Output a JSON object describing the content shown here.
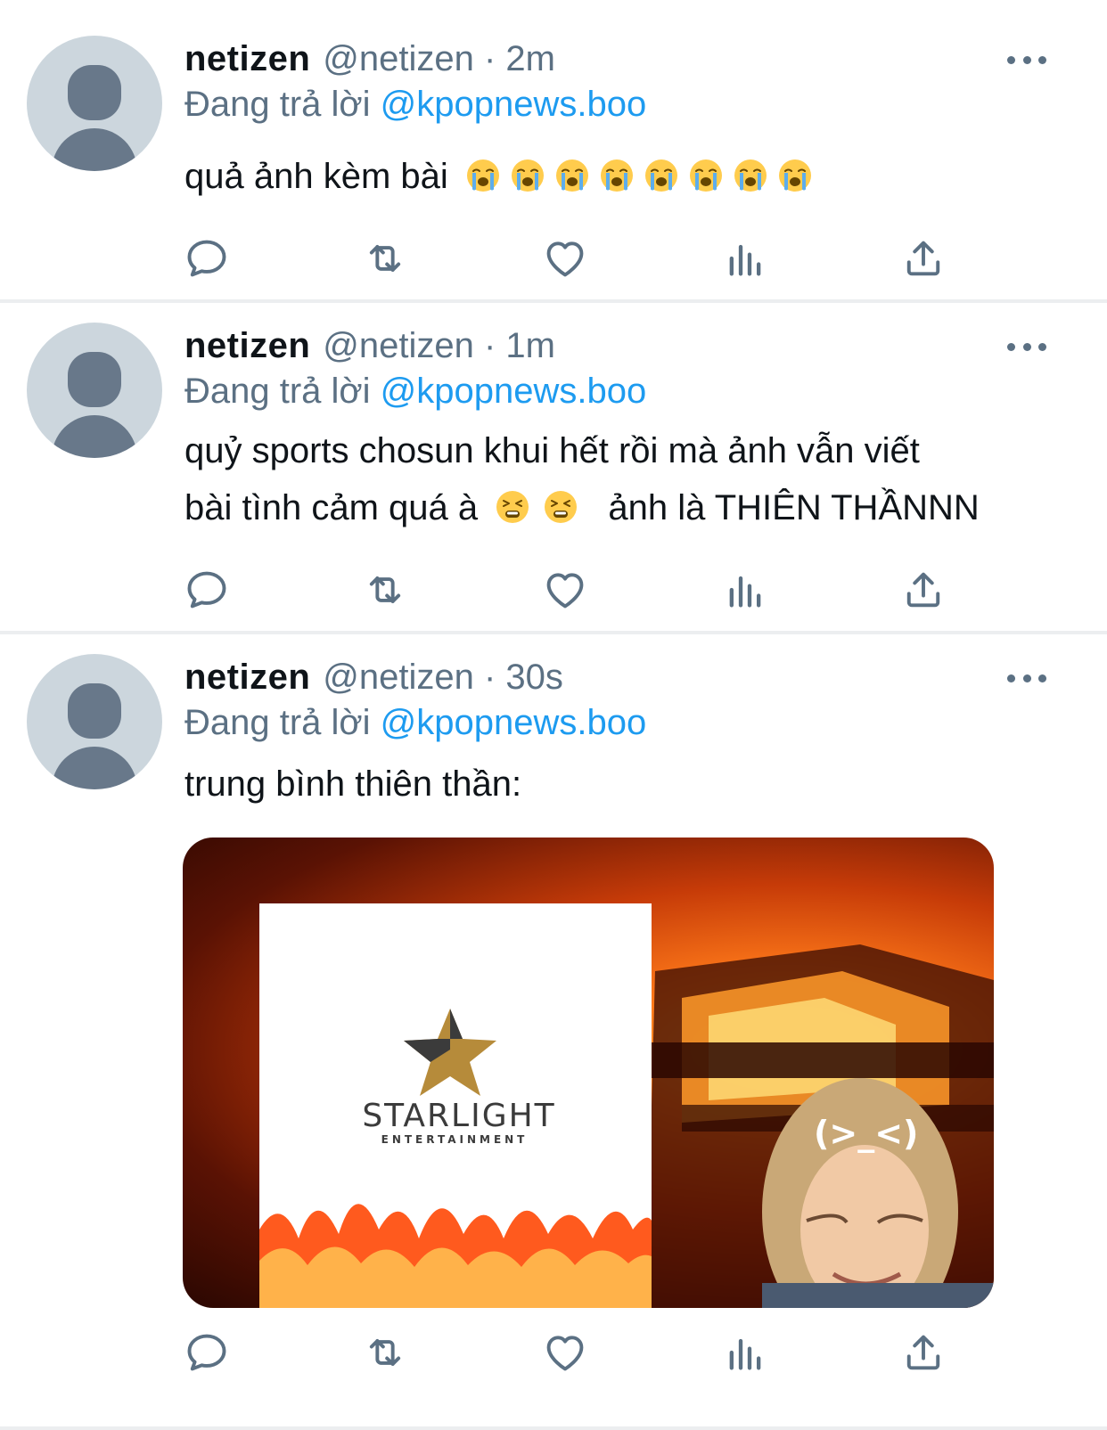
{
  "tweets": [
    {
      "name": "netizen",
      "handle_time": "@netizen · 2m",
      "reply_prefix": "Đang trả lời",
      "reply_mention": "@kpopnews.boo",
      "text_line1": "quả ảnh kèm bài",
      "emoji_count": 8,
      "emoji_name": "loudly-crying-face"
    },
    {
      "name": "netizen",
      "handle_time": "@netizen · 1m",
      "reply_prefix": "Đang trả lời",
      "reply_mention": "@kpopnews.boo",
      "text_line1": "quỷ sports chosun khui hết rồi mà ảnh vẫn viết",
      "text_line2_a": "bài tình cảm quá à",
      "text_line2_b": "ảnh là THIÊN THẦNNN",
      "emoji_name": "tired-face"
    },
    {
      "name": "netizen",
      "handle_time": "@netizen · 30s",
      "reply_prefix": "Đang trả lời",
      "reply_mention": "@kpopnews.boo",
      "text_line1": "trung bình thiên thần:",
      "media": {
        "logo_word": "STARLIGHT",
        "logo_sub": "ENTERTAINMENT",
        "sticker_text": "(>_<)"
      }
    }
  ],
  "action_icons": [
    "reply-icon",
    "retweet-icon",
    "like-icon",
    "analytics-icon",
    "share-icon"
  ],
  "colors": {
    "link": "#1d9bf0",
    "secondary": "#5b7083",
    "avatar_bg": "#ccd6dd",
    "avatar_fg": "#68788a",
    "divider": "#eceef0"
  }
}
